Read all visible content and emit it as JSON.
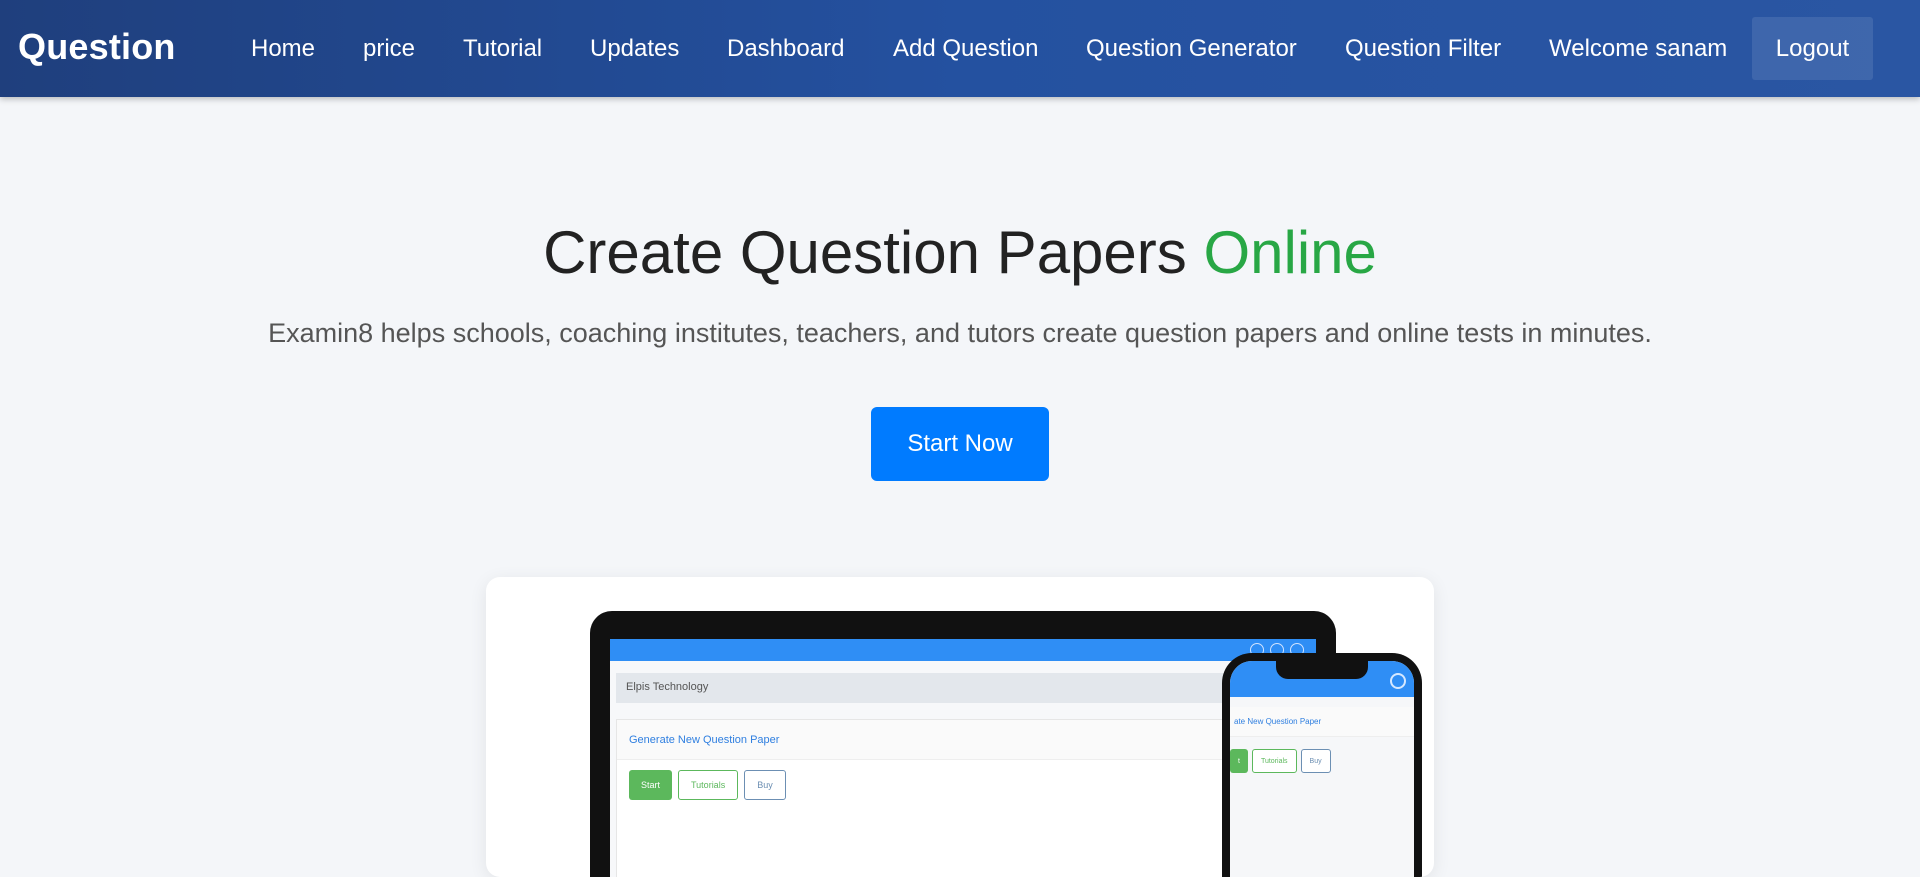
{
  "navbar": {
    "brand": "Question",
    "links": [
      "Home",
      "price",
      "Tutorial",
      "Updates",
      "Dashboard",
      "Add Question",
      "Question Generator",
      "Question Filter",
      "Welcome sanam"
    ],
    "logout_label": "Logout"
  },
  "hero": {
    "title_main": "Create Question Papers",
    "title_accent": "Online",
    "subtitle": "Examin8 helps schools, coaching institutes, teachers, and tutors create question papers and online tests in minutes.",
    "cta_label": "Start Now"
  },
  "preview": {
    "company": "Elpis Technology",
    "panel_title": "Generate New Question Paper",
    "phone_panel_title": "ate New Question Paper",
    "buttons": [
      "Start",
      "Tutorials",
      "Buy"
    ],
    "phone_buttons": [
      "t",
      "Tutorials",
      "Buy"
    ]
  },
  "colors": {
    "nav_bg": "#2451a0",
    "accent_green": "#28a745",
    "cta_blue": "#007bff"
  }
}
